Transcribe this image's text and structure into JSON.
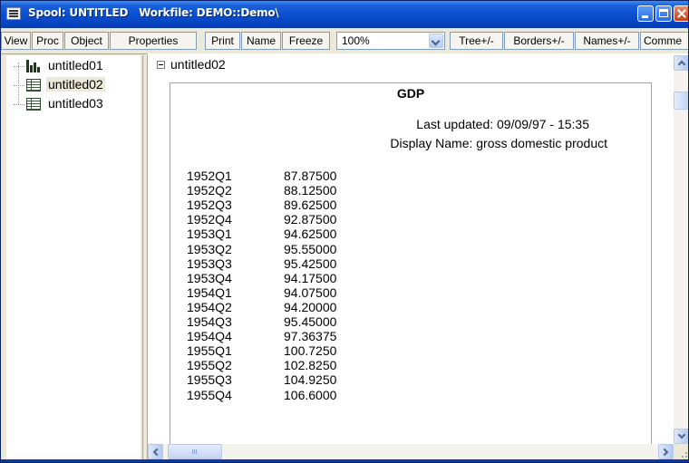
{
  "window": {
    "title": "Spool: UNTITLED   Workfile: DEMO::Demo\\"
  },
  "toolbar": {
    "view": "View",
    "proc": "Proc",
    "object": "Object",
    "properties": "Properties",
    "print": "Print",
    "name": "Name",
    "freeze": "Freeze",
    "zoom": "100%",
    "tree": "Tree+/-",
    "borders": "Borders+/-",
    "names": "Names+/-",
    "comments": "Comme"
  },
  "tree": {
    "items": [
      {
        "label": "untitled01",
        "icon": "graph-icon"
      },
      {
        "label": "untitled02",
        "icon": "table-icon",
        "selected": true
      },
      {
        "label": "untitled03",
        "icon": "table-icon"
      }
    ]
  },
  "content": {
    "node_label": "untitled02",
    "title": "GDP",
    "last_updated": "Last updated: 09/09/97 - 15:35",
    "display_name": "Display Name: gross domestic product",
    "rows": [
      {
        "date": "1952Q1",
        "value": "87.87500"
      },
      {
        "date": "1952Q2",
        "value": "88.12500"
      },
      {
        "date": "1952Q3",
        "value": "89.62500"
      },
      {
        "date": "1952Q4",
        "value": "92.87500"
      },
      {
        "date": "1953Q1",
        "value": "94.62500"
      },
      {
        "date": "1953Q2",
        "value": "95.55000"
      },
      {
        "date": "1953Q3",
        "value": "95.42500"
      },
      {
        "date": "1953Q4",
        "value": "94.17500"
      },
      {
        "date": "1954Q1",
        "value": "94.07500"
      },
      {
        "date": "1954Q2",
        "value": "94.20000"
      },
      {
        "date": "1954Q3",
        "value": "95.45000"
      },
      {
        "date": "1954Q4",
        "value": "97.36375"
      },
      {
        "date": "1955Q1",
        "value": "100.7250"
      },
      {
        "date": "1955Q2",
        "value": "102.8250"
      },
      {
        "date": "1955Q3",
        "value": "104.9250"
      },
      {
        "date": "1955Q4",
        "value": "106.6000"
      }
    ]
  },
  "colors": {
    "titlebar": "#0a4fd0",
    "chrome": "#ece9d8",
    "selected_item": "#ece9d8"
  }
}
